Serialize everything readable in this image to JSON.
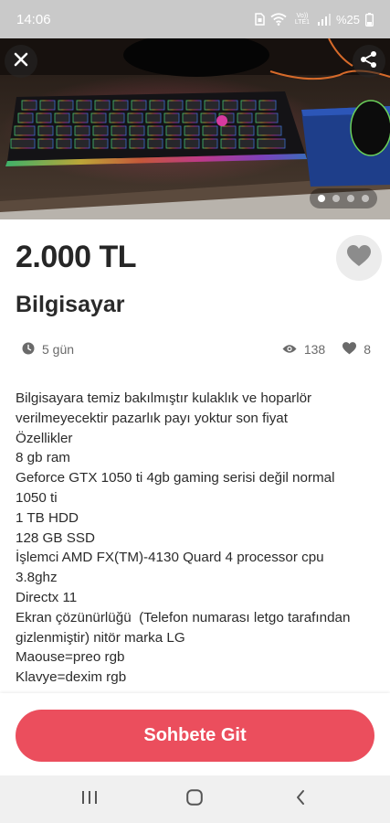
{
  "status_bar": {
    "time": "14:06",
    "volte_label": "Vo)) LTE1",
    "battery": "%25"
  },
  "hero": {
    "image_count": 4,
    "active_index": 0
  },
  "listing": {
    "price": "2.000 TL",
    "title": "Bilgisayar",
    "posted_ago": "5 gün",
    "view_count": "138",
    "like_count": "8",
    "description": "Bilgisayara temiz bakılmıştır kulaklık ve hoparlör\nverilmeyecektir pazarlık payı yoktur son fiyat\nÖzellikler\n8 gb ram\nGeforce GTX 1050 ti 4gb gaming serisi değil normal\n1050 ti\n1 TB HDD\n128 GB SSD\nİşlemci AMD FX(TM)-4130 Quard 4 processor cpu\n3.8ghz\nDirectx 11\nEkran çözünürlüğü  (Telefon numarası letgo tarafından\ngizlenmiştir) nitör marka LG\nMaouse=preo rgb\nKlavye=dexim rgb"
  },
  "actions": {
    "chat_label": "Sohbete Git"
  },
  "icons": {
    "close": "close-icon",
    "share": "share-icon",
    "favorite": "heart-icon",
    "clock": "clock-icon",
    "views": "eye-icon",
    "likes": "heart-icon"
  },
  "colors": {
    "accent": "#eb4e5d",
    "status_bar": "#c9c9c9",
    "meta_text": "#6a6a6a",
    "fav_bg": "#ececec"
  }
}
